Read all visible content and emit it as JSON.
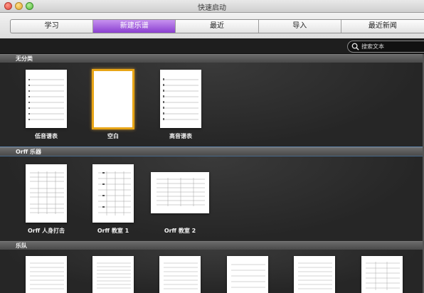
{
  "window": {
    "title": "快速启动"
  },
  "tabs": [
    {
      "label": "学习",
      "active": false
    },
    {
      "label": "新建乐谱",
      "active": true
    },
    {
      "label": "最近",
      "active": false
    },
    {
      "label": "导入",
      "active": false
    },
    {
      "label": "最近新闻",
      "active": false
    }
  ],
  "search": {
    "placeholder": "搜索文本",
    "icon": "search-icon"
  },
  "sections": [
    {
      "title": "无分类",
      "items": [
        {
          "label": "低音谱表",
          "selected": false
        },
        {
          "label": "空白",
          "selected": true
        },
        {
          "label": "高音谱表",
          "selected": false
        }
      ]
    },
    {
      "title": "Orff 乐器",
      "items": [
        {
          "label": "Orff 人身打击"
        },
        {
          "label": "Orff 教室 1"
        },
        {
          "label": "Orff 教室 2"
        }
      ]
    },
    {
      "title": "乐队",
      "items": [
        {},
        {},
        {},
        {},
        {},
        {}
      ]
    }
  ],
  "colors": {
    "active_tab": "#8a3fd0",
    "selection": "#e8a516",
    "background": "#262626"
  }
}
